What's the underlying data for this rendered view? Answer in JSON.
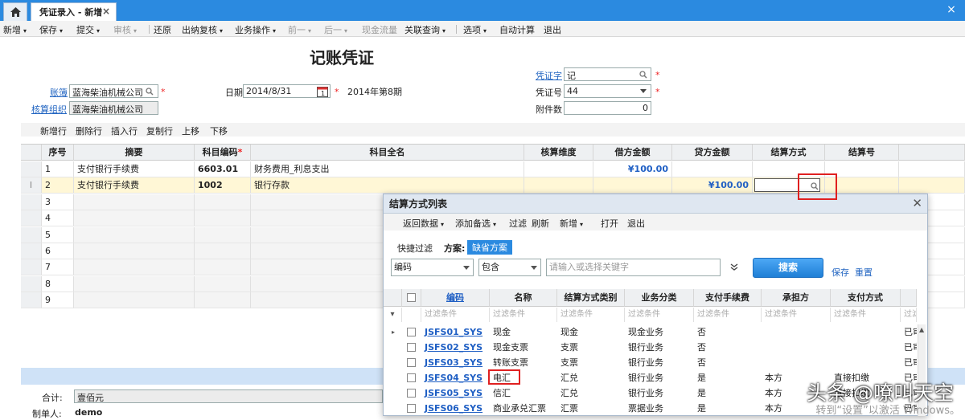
{
  "tabs": {
    "doc_title": "凭证录入 - 新增",
    "close": "×",
    "window_close": "×"
  },
  "toolbar": [
    {
      "label": "新增",
      "arrow": true
    },
    {
      "label": "保存",
      "arrow": true
    },
    {
      "label": "提交",
      "arrow": true
    },
    {
      "label": "审核",
      "arrow": true,
      "disabled": true
    },
    {
      "label": "还原"
    },
    {
      "label": "出纳复核",
      "arrow": true
    },
    {
      "label": "业务操作",
      "arrow": true
    },
    {
      "label": "前一",
      "arrow": true,
      "disabled": true
    },
    {
      "label": "后一",
      "arrow": true,
      "disabled": true
    },
    {
      "label": "现金流量",
      "disabled": true
    },
    {
      "label": "关联查询",
      "arrow": true
    },
    {
      "label": "选项",
      "arrow": true
    },
    {
      "label": "自动计算"
    },
    {
      "label": "退出"
    }
  ],
  "header": {
    "title": "记账凭证",
    "ledger_label": "账簿",
    "ledger_value": "蓝海柴油机械公司",
    "org_label": "核算组织",
    "org_value": "蓝海柴油机械公司",
    "date_label": "日期",
    "date_value": "2014/8/31",
    "period": "2014年第8期",
    "voucher_word_label": "凭证字",
    "voucher_word_value": "记",
    "voucher_no_label": "凭证号",
    "voucher_no_value": "44",
    "attach_label": "附件数",
    "attach_value": "0"
  },
  "grid_toolbar": [
    "新增行",
    "删除行",
    "插入行",
    "复制行",
    "上移",
    "下移"
  ],
  "grid": {
    "columns": [
      "序号",
      "摘要",
      "科目编码",
      "科目全名",
      "核算维度",
      "借方金额",
      "贷方金额",
      "结算方式",
      "结算号"
    ],
    "rows": [
      {
        "no": "1",
        "summary": "支付银行手续费",
        "code": "6603.01",
        "name": "财务费用_利息支出",
        "debit": "¥100.00",
        "credit": ""
      },
      {
        "no": "2",
        "summary": "支付银行手续费",
        "code": "1002",
        "name": "银行存款",
        "debit": "",
        "credit": "¥100.00"
      },
      {
        "no": "3"
      },
      {
        "no": "4"
      },
      {
        "no": "5"
      },
      {
        "no": "6"
      },
      {
        "no": "7"
      },
      {
        "no": "8"
      },
      {
        "no": "9"
      }
    ]
  },
  "footer": {
    "total_label": "合计:",
    "total_value": "壹佰元",
    "maker_label": "制单人:",
    "maker_value": "demo"
  },
  "dialog": {
    "title": "结算方式列表",
    "toolbar": [
      {
        "label": "返回数据",
        "arrow": true
      },
      {
        "label": "添加备选",
        "arrow": true
      },
      {
        "label": "过滤"
      },
      {
        "label": "刷新"
      },
      {
        "label": "新增",
        "arrow": true
      },
      {
        "label": "打开"
      },
      {
        "label": "退出"
      }
    ],
    "quick_filter_label": "快捷过滤",
    "scheme_label": "方案:",
    "scheme_value": "缺省方案",
    "filter_field": "编码",
    "filter_op": "包含",
    "filter_placeholder": "请输入或选择关键字",
    "search_button": "搜索",
    "save_link": "保存",
    "reset_link": "重置",
    "columns": [
      "编码",
      "名称",
      "结算方式类别",
      "业务分类",
      "支付手续费",
      "承担方",
      "支付方式"
    ],
    "filter_text": "过滤条件",
    "rows": [
      {
        "code": "JSFS01_SYS",
        "name": "现金",
        "category": "现金",
        "biz": "现金业务",
        "fee": "否",
        "bearer": "",
        "pay": "",
        "status": "已审"
      },
      {
        "code": "JSFS02_SYS",
        "name": "现金支票",
        "category": "支票",
        "biz": "银行业务",
        "fee": "否",
        "bearer": "",
        "pay": "",
        "status": "已审"
      },
      {
        "code": "JSFS03_SYS",
        "name": "转账支票",
        "category": "支票",
        "biz": "银行业务",
        "fee": "否",
        "bearer": "",
        "pay": "",
        "status": "已审"
      },
      {
        "code": "JSFS04_SYS",
        "name": "电汇",
        "category": "汇兑",
        "biz": "银行业务",
        "fee": "是",
        "bearer": "本方",
        "pay": "直接扣缴",
        "status": "已审"
      },
      {
        "code": "JSFS05_SYS",
        "name": "信汇",
        "category": "汇兑",
        "biz": "银行业务",
        "fee": "是",
        "bearer": "本方",
        "pay": "直接扣缴",
        "status": "已审"
      },
      {
        "code": "JSFS06_SYS",
        "name": "商业承兑汇票",
        "category": "汇票",
        "biz": "票据业务",
        "fee": "是",
        "bearer": "本方",
        "pay": "",
        "status": "已审"
      }
    ]
  },
  "watermark": "头条 @嘹叫天空",
  "activation": "转到“设置”以激活 Windows。"
}
